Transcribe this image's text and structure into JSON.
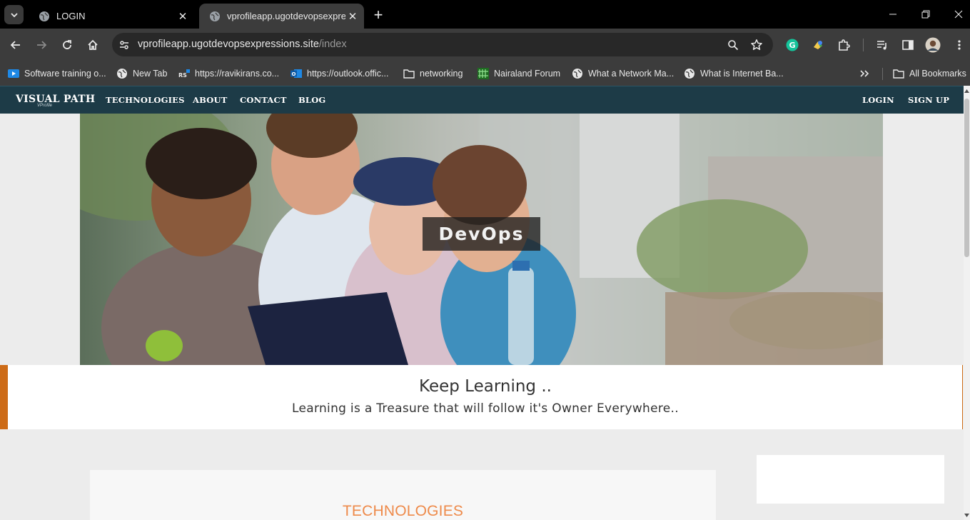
{
  "browser": {
    "tabs": [
      {
        "title": "LOGIN",
        "active": false
      },
      {
        "title": "vprofileapp.ugotdevopsexpressions.site/index",
        "active": true
      }
    ],
    "url": {
      "host": "vprofileapp.ugotdevopsexpressions.site",
      "path": "/index"
    },
    "bookmarks": [
      {
        "label": "Software training o...",
        "icon": "youtube-icon"
      },
      {
        "label": "New Tab",
        "icon": "globe-icon"
      },
      {
        "label": "https://ravikirans.co...",
        "icon": "rs-icon"
      },
      {
        "label": "https://outlook.offic...",
        "icon": "outlook-icon"
      },
      {
        "label": "networking",
        "icon": "folder-icon"
      },
      {
        "label": "Nairaland Forum",
        "icon": "nairaland-icon"
      },
      {
        "label": "What a Network Ma...",
        "icon": "globe-icon"
      },
      {
        "label": "What is Internet Ba...",
        "icon": "globe-icon"
      }
    ],
    "all_bookmarks_label": "All Bookmarks"
  },
  "site": {
    "brand": "VISUAL PATH",
    "brand_sub": "VProfile",
    "nav": [
      "TECHNOLOGIES",
      "ABOUT",
      "CONTACT",
      "BLOG"
    ],
    "auth": {
      "login": "LOGIN",
      "signup": "SIGN UP"
    },
    "hero_label": "DevOps",
    "quote_title": "Keep Learning ..",
    "quote_sub": "Learning is a Treasure that will follow it's Owner Everywhere..",
    "section_title": "TECHNOLOGIES"
  },
  "colors": {
    "nav_bg": "#1d3b47",
    "accent_border": "#cd6b17",
    "section_title": "#ee8a4a"
  }
}
